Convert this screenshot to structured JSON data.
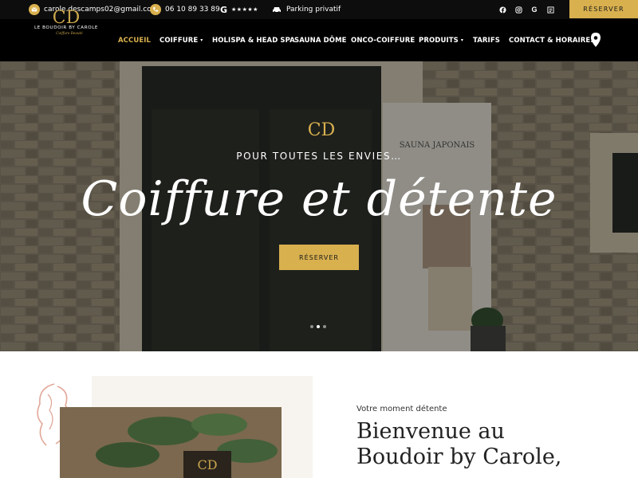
{
  "topbar": {
    "email": "carole.descamps02@gmail.com",
    "phone": "06 10 89 33 89",
    "rating_stars": "★★★★★",
    "parking": "Parking privatif",
    "social_google_label": "G",
    "reserve_label": "RÉSERVER",
    "accent_color": "#d8b04e"
  },
  "nav": {
    "items": [
      {
        "label": "ACCUEIL"
      },
      {
        "label": "COIFFURE"
      },
      {
        "label": "HOLISPA & HEAD SPA"
      },
      {
        "label": "SAUNA DÔME"
      },
      {
        "label": "ONCO-COIFFURE"
      },
      {
        "label": "PRODUITS"
      },
      {
        "label": "TARIFS"
      },
      {
        "label": "CONTACT & HORAIRES"
      }
    ],
    "chevron": "▾",
    "pin_icon": "map-pin-icon"
  },
  "logo": {
    "monogram": "CD",
    "name": "LE BOUDOIR BY CAROLE",
    "tagline": "Coiffure Beauté"
  },
  "hero": {
    "monogram": "CD",
    "subtitle": "POUR TOUTES LES ENVIES…",
    "title": "Coiffure et détente",
    "button": "RÉSERVER",
    "banner_text": "SAUNA JAPONAIS",
    "slides": 3,
    "active_slide": 2
  },
  "intro": {
    "kicker": "Votre moment détente",
    "heading_line1": "Bienvenue au",
    "heading_line2": "Boudoir by Carole,"
  }
}
